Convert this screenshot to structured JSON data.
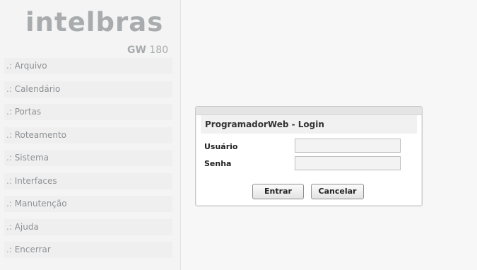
{
  "brand": {
    "logo_text": "intelbras",
    "model_prefix": "GW",
    "model_number": "180"
  },
  "menu": {
    "items": [
      {
        "prefix": ".:",
        "label": "Arquivo"
      },
      {
        "prefix": ".:",
        "label": "Calendário"
      },
      {
        "prefix": ".:",
        "label": "Portas"
      },
      {
        "prefix": ".:",
        "label": "Roteamento"
      },
      {
        "prefix": ".:",
        "label": "Sistema"
      },
      {
        "prefix": ".:",
        "label": "Interfaces"
      },
      {
        "prefix": ".:",
        "label": "Manutenção"
      },
      {
        "prefix": ".:",
        "label": "Ajuda"
      },
      {
        "prefix": ".:",
        "label": "Encerrar"
      }
    ]
  },
  "login": {
    "title": "ProgramadorWeb - Login",
    "user_label": "Usuário",
    "user_value": "",
    "password_label": "Senha",
    "password_value": "",
    "submit_label": "Entrar",
    "cancel_label": "Cancelar"
  },
  "colors": {
    "logo_gray": "#a9acae",
    "sidebar_bg": "#f4f4f4",
    "menu_item_bg": "#efefef",
    "menu_text": "#8e9194"
  }
}
